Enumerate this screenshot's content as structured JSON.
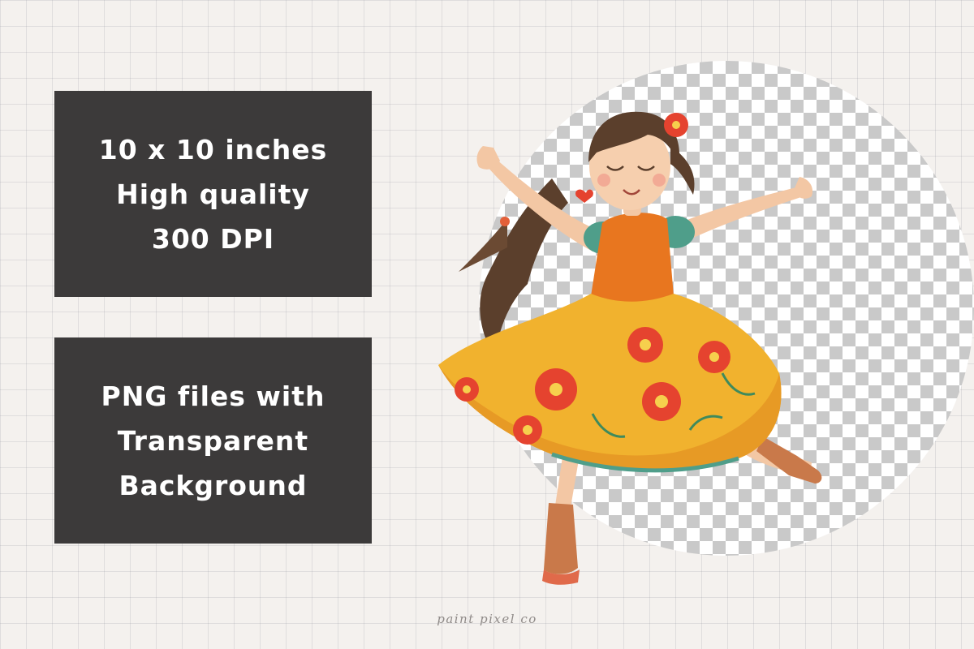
{
  "spec_box": {
    "lines": [
      "10 x 10 inches",
      "High quality",
      "300 DPI"
    ]
  },
  "format_box": {
    "lines": [
      "PNG files with",
      "Transparent",
      "Background"
    ]
  },
  "watermark": "paint pixel co",
  "illustration": {
    "subject": "dancing-girl-illustration"
  },
  "colors": {
    "box_bg": "#3c3a3a",
    "box_text": "#ffffff",
    "paper": "#f4f1ee",
    "checker_dark": "#c9c9c9",
    "dress_top": "#e8761f",
    "skirt": "#f1b22e",
    "flower": "#e5432f",
    "sleeve": "#4f9e8a",
    "hair": "#5b3f2c",
    "skin": "#f6cfae"
  }
}
